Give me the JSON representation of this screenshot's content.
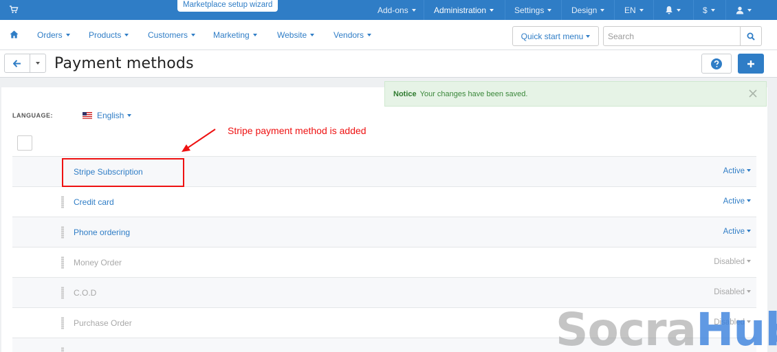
{
  "topbar": {
    "wizard_label": "Marketplace setup wizard",
    "menus": [
      "Add-ons",
      "Administration",
      "Settings",
      "Design",
      "EN",
      "$"
    ],
    "icons": [
      "cart-icon",
      "bell-icon",
      "user-icon"
    ]
  },
  "navbar": {
    "items": [
      "Orders",
      "Products",
      "Customers",
      "Marketing",
      "Website",
      "Vendors"
    ],
    "quick_start_label": "Quick start menu",
    "search_placeholder": "Search"
  },
  "titlebar": {
    "title": "Payment methods"
  },
  "notice": {
    "label": "Notice",
    "message": "Your changes have been saved."
  },
  "language": {
    "label": "LANGUAGE:",
    "value": "English"
  },
  "payment_methods": [
    {
      "name": "Stripe Subscription",
      "status": "Active",
      "enabled": true
    },
    {
      "name": "Credit card",
      "status": "Active",
      "enabled": true
    },
    {
      "name": "Phone ordering",
      "status": "Active",
      "enabled": true
    },
    {
      "name": "Money Order",
      "status": "Disabled",
      "enabled": false
    },
    {
      "name": "C.O.D",
      "status": "Disabled",
      "enabled": false
    },
    {
      "name": "Purchase Order",
      "status": "Disabled",
      "enabled": false
    }
  ],
  "annotation": {
    "text": "Stripe payment method is added",
    "color": "#ee1111"
  },
  "watermark": {
    "part1": "Socra",
    "part2": "Hub"
  },
  "colors": {
    "accent": "#2f7dc6",
    "notice_bg": "#e6f3e6"
  }
}
